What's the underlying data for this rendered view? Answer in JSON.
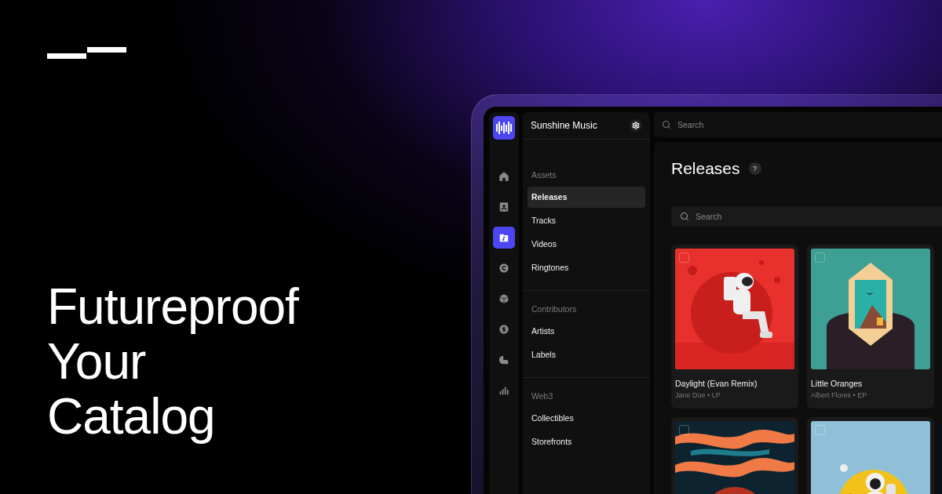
{
  "headline": {
    "lines": [
      "Futureproof",
      "Your",
      "Catalog"
    ]
  },
  "rail": {
    "items": [
      {
        "kind": "home",
        "selected": false
      },
      {
        "kind": "contact",
        "selected": false
      },
      {
        "kind": "folder",
        "selected": true
      },
      {
        "kind": "copyright",
        "selected": false
      },
      {
        "kind": "cube",
        "selected": false
      },
      {
        "kind": "dollar",
        "selected": false
      },
      {
        "kind": "pie",
        "selected": false
      },
      {
        "kind": "bars",
        "selected": false
      }
    ]
  },
  "workspace": {
    "title": "Sunshine Music"
  },
  "nav": {
    "sections": [
      {
        "title": "Assets",
        "items": [
          {
            "label": "Releases",
            "selected": true
          },
          {
            "label": "Tracks",
            "selected": false
          },
          {
            "label": "Videos",
            "selected": false
          },
          {
            "label": "Ringtones",
            "selected": false
          }
        ]
      },
      {
        "title": "Contributors",
        "items": [
          {
            "label": "Artists",
            "selected": false
          },
          {
            "label": "Labels",
            "selected": false
          }
        ]
      },
      {
        "title": "Web3",
        "items": [
          {
            "label": "Collectibles",
            "selected": false
          },
          {
            "label": "Storefronts",
            "selected": false
          }
        ]
      }
    ]
  },
  "top_search": {
    "placeholder": "Search"
  },
  "page": {
    "title": "Releases",
    "help": "?"
  },
  "search": {
    "placeholder": "Search"
  },
  "releases": [
    {
      "title": "Daylight (Evan Remix)",
      "subtitle": "Jane Doe • LP",
      "checked": false
    },
    {
      "title": "Little Oranges",
      "subtitle": "Albert Flores • EP",
      "checked": false
    },
    {
      "checked": false
    },
    {
      "checked": false
    }
  ]
}
